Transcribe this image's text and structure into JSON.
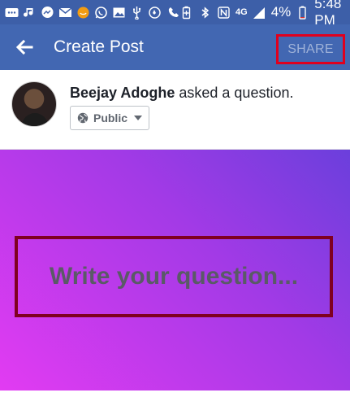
{
  "status_bar": {
    "network_type": "4G",
    "battery": "4%",
    "time": "5:48 PM"
  },
  "app_bar": {
    "title": "Create Post",
    "share_label": "SHARE"
  },
  "author": {
    "name": "Beejay Adoghe",
    "action": " asked a question."
  },
  "audience": {
    "selected": "Public"
  },
  "question": {
    "placeholder": "Write your question..."
  },
  "colors": {
    "status_bar": "#3d5fa8",
    "app_bar": "#4267b2",
    "share_highlight": "#e0001e",
    "question_highlight": "#7f0020",
    "gradient_start": "#6b3fdc",
    "gradient_end": "#e23bf2"
  }
}
